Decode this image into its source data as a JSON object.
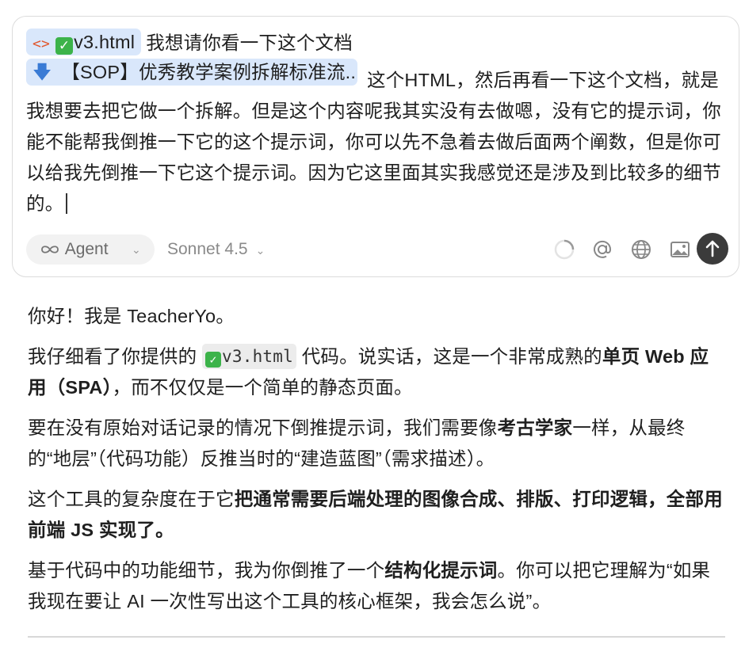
{
  "composer": {
    "file_chip": "v3.html",
    "doc_chip": "【SOP】优秀教学案例拆解标准流...",
    "text_after_file": "我想请你看一下这个文档",
    "text_after_doc": "这个HTML，然后再看一下这个文档，就是我想要去把它做一个拆解。但是这个内容呢我其实没有去做嗯，没有它的提示词，你能不能帮我倒推一下它的这个提示词，你可以先不急着去做后面两个阐数，但是你可以给我先倒推一下它这个提示词。因为它这里面其实我感觉还是涉及到比较多的细节的。",
    "mode_label": "Agent",
    "model_label": "Sonnet 4.5"
  },
  "icons": [
    "code-icon",
    "check-icon",
    "arrow-down-icon",
    "infinity-icon",
    "chevron-down-icon",
    "spinner-icon",
    "at-icon",
    "globe-icon",
    "image-icon",
    "send-arrow-up-icon"
  ],
  "colors": {
    "chip_bg": "#d9e7fb",
    "check_green": "#3cb34a",
    "send_bg": "#3b3b3b",
    "pill_bg": "#f2f2f2"
  },
  "response": {
    "p1": "你好！我是 TeacherYo。",
    "p2_a": "我仔细看了你提供的",
    "p2_code": "v3.html",
    "p2_b": "代码。说实话，这是一个非常成熟的",
    "p2_bold": "单页 Web 应用（SPA）",
    "p2_c": "，而不仅仅是一个简单的静态页面。",
    "p3_a": "要在没有原始对话记录的情况下倒推提示词，我们需要像",
    "p3_bold": "考古学家",
    "p3_b": "一样，从最终的“地层”（代码功能）反推当时的“建造蓝图”（需求描述）。",
    "p4_a": "这个工具的复杂度在于它",
    "p4_bold": "把通常需要后端处理的图像合成、排版、打印逻辑，全部用前端 JS 实现了。",
    "p5_a": "基于代码中的功能细节，我为你倒推了一个",
    "p5_bold": "结构化提示词",
    "p5_b": "。你可以把它理解为“如果我现在要让 AI 一次性写出这个工具的核心框架，我会怎么说”。"
  }
}
